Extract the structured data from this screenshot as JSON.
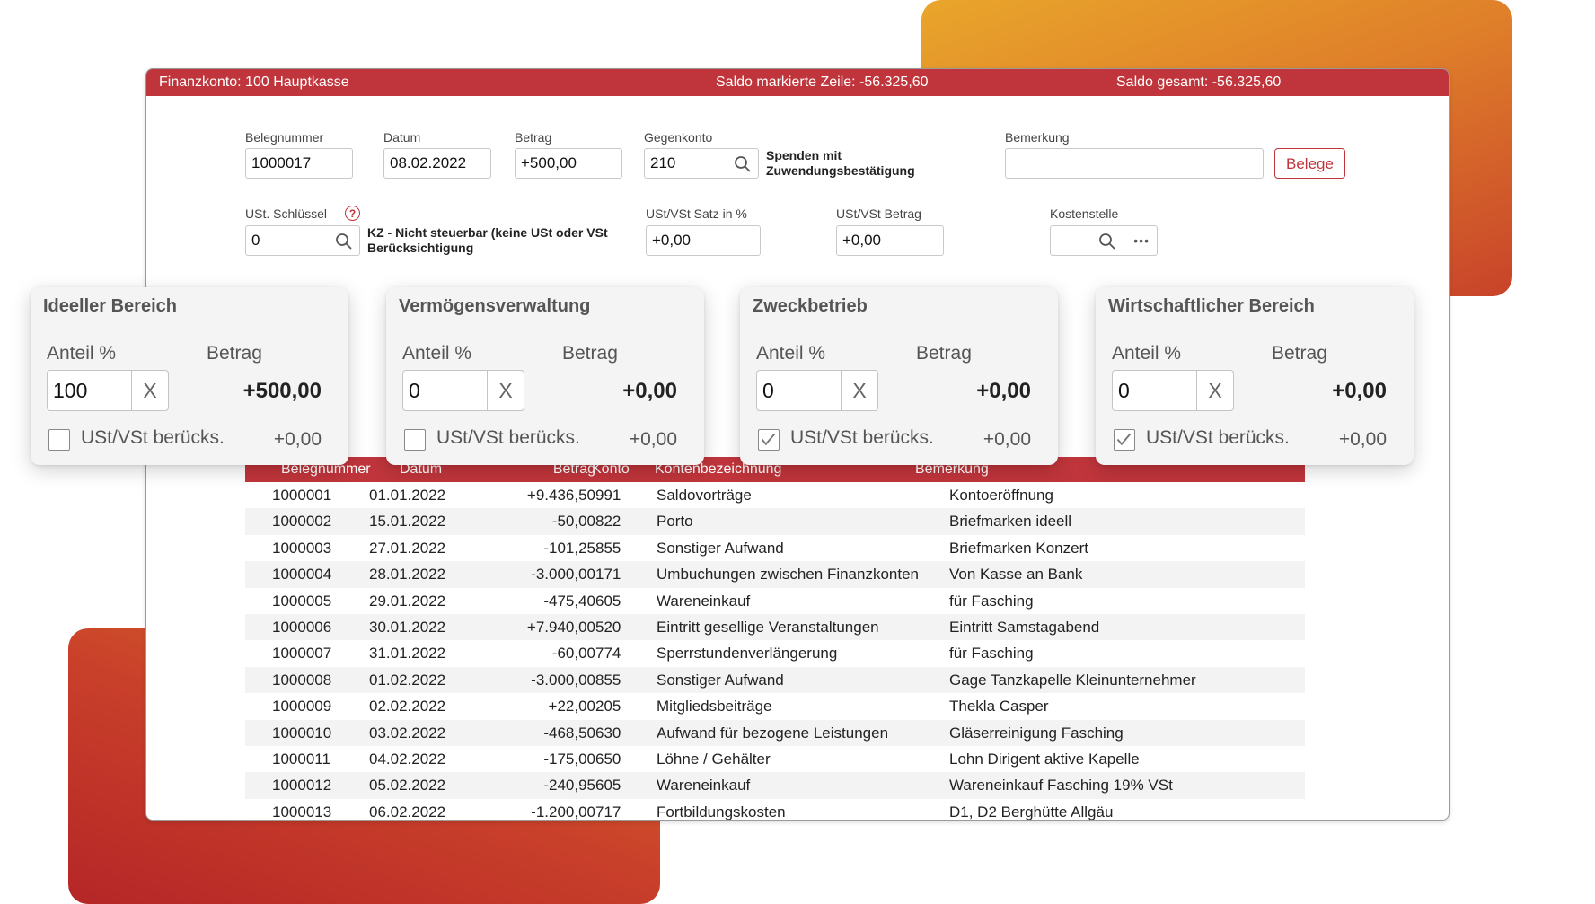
{
  "titlebar": {
    "account": "Finanzkonto: 100 Hauptkasse",
    "saldo_marked": "Saldo markierte Zeile: -56.325,60",
    "saldo_total": "Saldo gesamt: -56.325,60"
  },
  "form": {
    "belegnummer": {
      "label": "Belegnummer",
      "value": "1000017"
    },
    "datum": {
      "label": "Datum",
      "value": "08.02.2022"
    },
    "betrag": {
      "label": "Betrag",
      "value": "+500,00"
    },
    "gegenkonto": {
      "label": "Gegenkonto",
      "value": "210",
      "note_line1": "Spenden mit",
      "note_line2": "Zuwendungsbestätigung"
    },
    "bemerkung": {
      "label": "Bemerkung",
      "value": "",
      "button": "Belege"
    },
    "ust_schluessel": {
      "label": "USt. Schlüssel",
      "help": "?",
      "value": "0",
      "note_line1": "KZ - Nicht steuerbar (keine USt oder VSt",
      "note_line2": "Berücksichtigung"
    },
    "ust_satz": {
      "label": "USt/VSt Satz in %",
      "value": "+0,00"
    },
    "ust_betrag": {
      "label": "USt/VSt Betrag",
      "value": "+0,00"
    },
    "kostenstelle": {
      "label": "Kostenstelle",
      "value": "",
      "more": "•••"
    }
  },
  "table": {
    "headers": [
      "Belegnummer",
      "Datum",
      "Betrag",
      "Konto",
      "Kontenbezeichnung",
      "Bemerkung"
    ],
    "rows": [
      [
        "1000001",
        "01.01.2022",
        "+9.436,50",
        "991",
        "Saldovorträge",
        "Kontoeröffnung"
      ],
      [
        "1000002",
        "15.01.2022",
        "-50,00",
        "822",
        "Porto",
        "Briefmarken ideell"
      ],
      [
        "1000003",
        "27.01.2022",
        "-101,25",
        "855",
        "Sonstiger Aufwand",
        "Briefmarken Konzert"
      ],
      [
        "1000004",
        "28.01.2022",
        "-3.000,00",
        "171",
        "Umbuchungen zwischen Finanzkonten",
        "Von Kasse an Bank"
      ],
      [
        "1000005",
        "29.01.2022",
        "-475,40",
        "605",
        "Wareneinkauf",
        "für Fasching"
      ],
      [
        "1000006",
        "30.01.2022",
        "+7.940,00",
        "520",
        "Eintritt gesellige Veranstaltungen",
        "Eintritt Samstagabend"
      ],
      [
        "1000007",
        "31.01.2022",
        "-60,00",
        "774",
        "Sperrstundenverlängerung",
        "für Fasching"
      ],
      [
        "1000008",
        "01.02.2022",
        "-3.000,00",
        "855",
        "Sonstiger Aufwand",
        "Gage Tanzkapelle Kleinunternehmer"
      ],
      [
        "1000009",
        "02.02.2022",
        "+22,00",
        "205",
        "Mitgliedsbeiträge",
        "Thekla Casper"
      ],
      [
        "1000010",
        "03.02.2022",
        "-468,50",
        "630",
        "Aufwand für bezogene Leistungen",
        "Gläserreinigung Fasching"
      ],
      [
        "1000011",
        "04.02.2022",
        "-175,00",
        "650",
        "Löhne / Gehälter",
        "Lohn Dirigent aktive Kapelle"
      ],
      [
        "1000012",
        "05.02.2022",
        "-240,95",
        "605",
        "Wareneinkauf",
        "Wareneinkauf Fasching 19% VSt"
      ],
      [
        "1000013",
        "06.02.2022",
        "-1.200,00",
        "717",
        "Fortbildungskosten",
        "D1, D2 Berghütte Allgäu"
      ]
    ]
  },
  "cards": [
    {
      "title": "Ideeller Bereich",
      "anteil_label": "Anteil %",
      "betrag_label": "Betrag",
      "anteil": "100",
      "clear": "X",
      "betrag": "+500,00",
      "checkbox_label": "USt/VSt berücks.",
      "checked": false,
      "vst": "+0,00"
    },
    {
      "title": "Vermögensverwaltung",
      "anteil_label": "Anteil %",
      "betrag_label": "Betrag",
      "anteil": "0",
      "clear": "X",
      "betrag": "+0,00",
      "checkbox_label": "USt/VSt berücks.",
      "checked": false,
      "vst": "+0,00"
    },
    {
      "title": "Zweckbetrieb",
      "anteil_label": "Anteil %",
      "betrag_label": "Betrag",
      "anteil": "0",
      "clear": "X",
      "betrag": "+0,00",
      "checkbox_label": "USt/VSt berücks.",
      "checked": true,
      "vst": "+0,00"
    },
    {
      "title": "Wirtschaftlicher Bereich",
      "anteil_label": "Anteil %",
      "betrag_label": "Betrag",
      "anteil": "0",
      "clear": "X",
      "betrag": "+0,00",
      "checkbox_label": "USt/VSt berücks.",
      "checked": true,
      "vst": "+0,00"
    }
  ],
  "colors": {
    "accent": "#c0353b",
    "gradient_orange": "#e9a62b",
    "gradient_red": "#b52627"
  }
}
